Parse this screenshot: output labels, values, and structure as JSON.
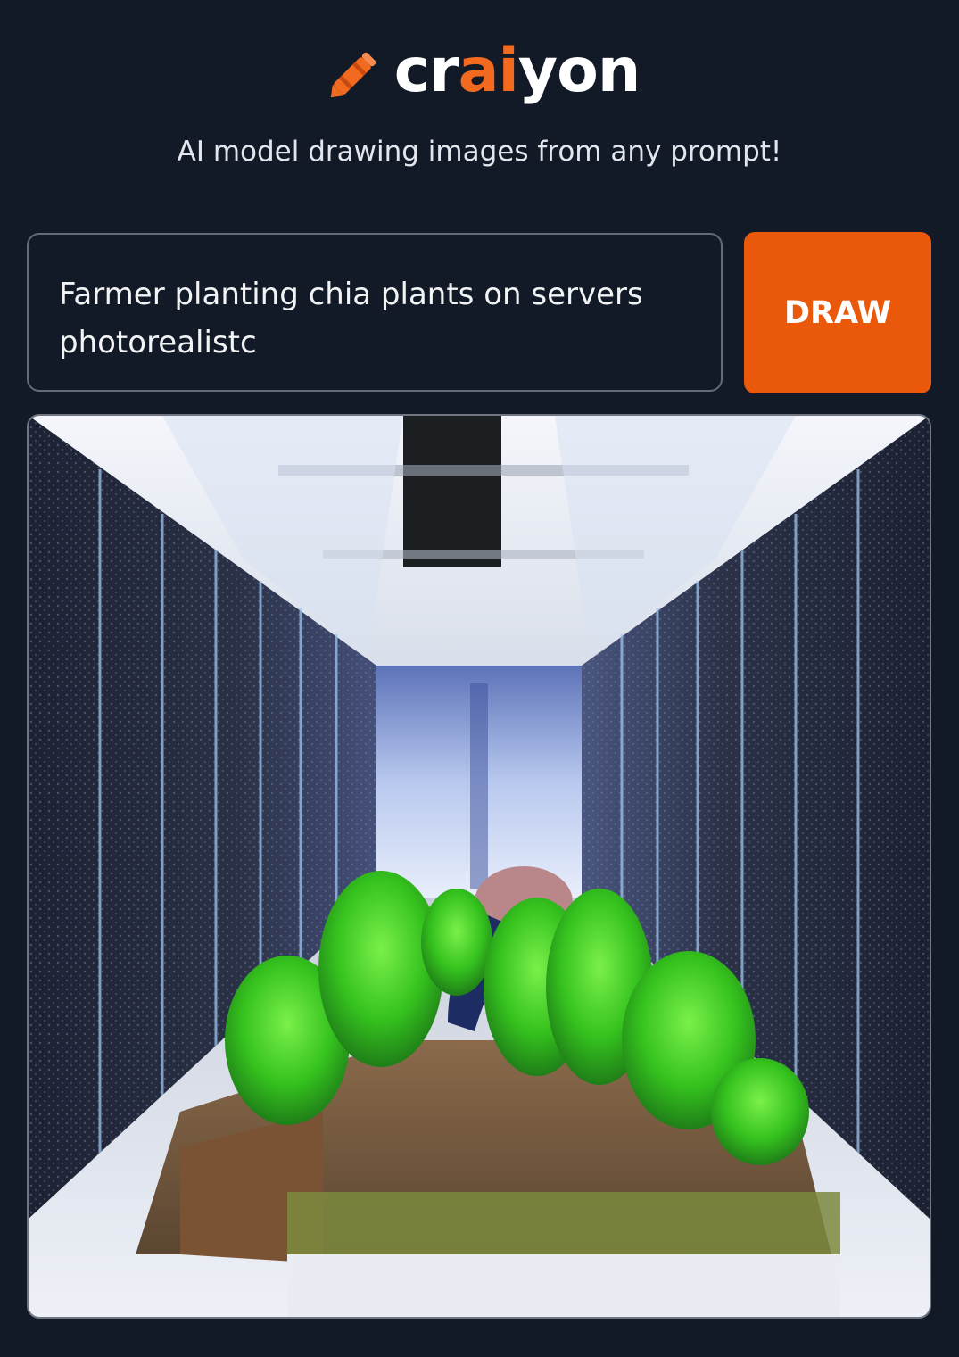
{
  "header": {
    "logo_text_prefix": "cr",
    "logo_text_accent": "ai",
    "logo_text_suffix": "yon",
    "logo_icon": "crayon-icon",
    "subtitle": "AI model drawing images from any prompt!"
  },
  "prompt": {
    "value": "Farmer planting chia plants on servers photorealistc"
  },
  "draw_button": {
    "label": "DRAW"
  },
  "colors": {
    "background": "#131a27",
    "accent": "#ea580c",
    "logo_accent": "#f26a1f"
  }
}
